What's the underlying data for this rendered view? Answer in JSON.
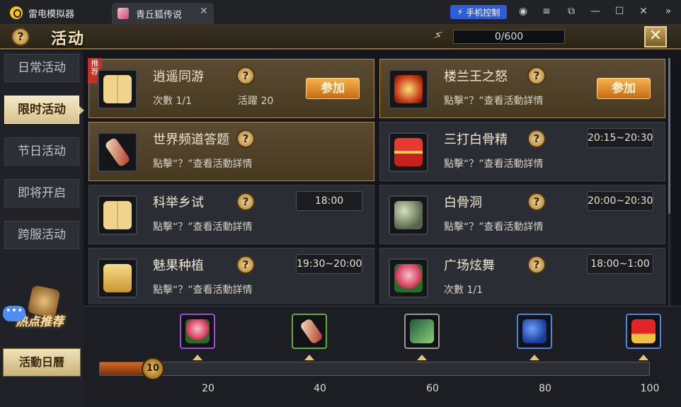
{
  "emulator": {
    "app_name": "雷电模拟器",
    "tab_title": "青丘狐传说",
    "tab_close": "✕",
    "phone_control_label": "手机控制",
    "window_buttons": [
      "◉",
      "≡",
      "⧉",
      "—",
      "☐",
      "✕",
      "»"
    ]
  },
  "header": {
    "help_glyph": "?",
    "title": "活动",
    "energy_value": "0/600",
    "close_glyph": "✕"
  },
  "sidebar": {
    "items": [
      {
        "label": "日常活动",
        "active": false
      },
      {
        "label": "限时活动",
        "active": true
      },
      {
        "label": "节日活动",
        "active": false
      },
      {
        "label": "即将开启",
        "active": false
      },
      {
        "label": "跨服活动",
        "active": false
      }
    ],
    "hot_recommend_label": "热点推荐",
    "chat_glyph": "•••",
    "calendar_label": "活動日曆"
  },
  "activities": [
    {
      "name": "逍遥同游",
      "icon": "book-icon",
      "ribbon": "推荐",
      "sub": "次數  1/1",
      "sub2": "活躍  20",
      "join_label": "参加",
      "highlight": true
    },
    {
      "name": "楼兰王之怒",
      "icon": "flame-icon",
      "sub": "點擊“？”查看活動詳情",
      "join_label": "参加",
      "highlight": true
    },
    {
      "name": "世界频道答题",
      "icon": "scroll-icon",
      "sub": "點擊“？”查看活動詳情",
      "highlight": true
    },
    {
      "name": "三打白骨精",
      "icon": "gift-icon",
      "sub": "點擊“？”查看活動詳情",
      "time": "20:15~20:30"
    },
    {
      "name": "科举乡试",
      "icon": "book-icon",
      "sub": "點擊“？”查看活動詳情",
      "time": "18:00"
    },
    {
      "name": "白骨洞",
      "icon": "orb-icon",
      "sub": "點擊“？”查看活動詳情",
      "time": "20:00~20:30"
    },
    {
      "name": "魅果种植",
      "icon": "banner-icon",
      "sub": "點擊“？”查看活動詳情",
      "time": "19:30~20:00"
    },
    {
      "name": "广场炫舞",
      "icon": "flower-icon",
      "sub": "次數  1/1",
      "time": "18:00~1:00"
    }
  ],
  "help_glyph": "?",
  "rewards": {
    "items": [
      {
        "icon": "flower-reward-icon",
        "threshold": "20",
        "border": "#9b4fd8"
      },
      {
        "icon": "scroll-reward-icon",
        "threshold": "40",
        "border": "#5fae3a"
      },
      {
        "icon": "feather-reward-icon",
        "threshold": "60",
        "border": "#9a9a9a"
      },
      {
        "icon": "bag-reward-icon",
        "threshold": "80",
        "border": "#4f86d8"
      },
      {
        "icon": "redpacket-reward-icon",
        "threshold": "100",
        "border": "#4f86d8"
      }
    ],
    "current_value": "10",
    "max_value": 100
  }
}
